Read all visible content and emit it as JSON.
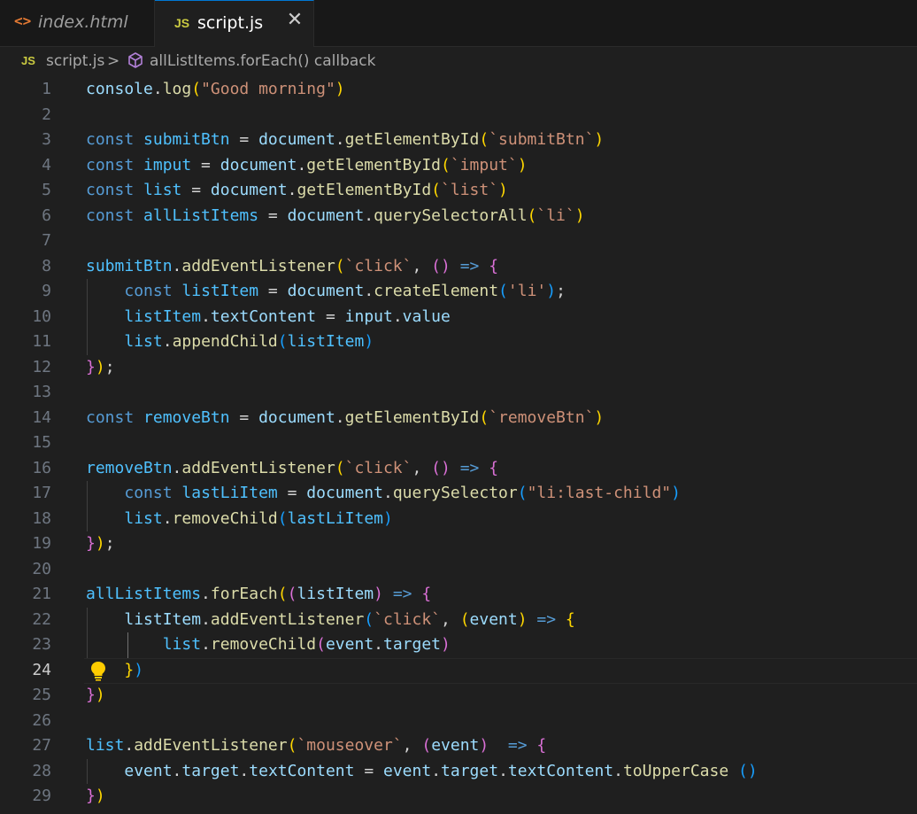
{
  "tabs": [
    {
      "label": "index.html",
      "icon": "<>",
      "active": false
    },
    {
      "label": "script.js",
      "icon": "JS",
      "active": true,
      "close": "✕"
    }
  ],
  "breadcrumb": {
    "file_icon": "JS",
    "file": "script.js",
    "separator": ">",
    "symbol": "allListItems.forEach() callback"
  },
  "editor": {
    "current_line": 24,
    "lines": [
      {
        "n": "1",
        "tokens": [
          [
            "v",
            "console"
          ],
          [
            "p",
            "."
          ],
          [
            "f",
            "log"
          ],
          [
            "b1",
            "("
          ],
          [
            "s",
            "\"Good morning\""
          ],
          [
            "b1",
            ")"
          ]
        ]
      },
      {
        "n": "2",
        "tokens": []
      },
      {
        "n": "3",
        "tokens": [
          [
            "k",
            "const "
          ],
          [
            "c",
            "submitBtn"
          ],
          [
            "p",
            " = "
          ],
          [
            "v",
            "document"
          ],
          [
            "p",
            "."
          ],
          [
            "f",
            "getElementById"
          ],
          [
            "b1",
            "("
          ],
          [
            "s",
            "`submitBtn`"
          ],
          [
            "b1",
            ")"
          ]
        ]
      },
      {
        "n": "4",
        "tokens": [
          [
            "k",
            "const "
          ],
          [
            "c",
            "imput"
          ],
          [
            "p",
            " = "
          ],
          [
            "v",
            "document"
          ],
          [
            "p",
            "."
          ],
          [
            "f",
            "getElementById"
          ],
          [
            "b1",
            "("
          ],
          [
            "s",
            "`imput`"
          ],
          [
            "b1",
            ")"
          ]
        ]
      },
      {
        "n": "5",
        "tokens": [
          [
            "k",
            "const "
          ],
          [
            "c",
            "list"
          ],
          [
            "p",
            " = "
          ],
          [
            "v",
            "document"
          ],
          [
            "p",
            "."
          ],
          [
            "f",
            "getElementById"
          ],
          [
            "b1",
            "("
          ],
          [
            "s",
            "`list`"
          ],
          [
            "b1",
            ")"
          ]
        ]
      },
      {
        "n": "6",
        "tokens": [
          [
            "k",
            "const "
          ],
          [
            "c",
            "allListItems"
          ],
          [
            "p",
            " = "
          ],
          [
            "v",
            "document"
          ],
          [
            "p",
            "."
          ],
          [
            "f",
            "querySelectorAll"
          ],
          [
            "b1",
            "("
          ],
          [
            "s",
            "`li`"
          ],
          [
            "b1",
            ")"
          ]
        ]
      },
      {
        "n": "7",
        "tokens": []
      },
      {
        "n": "8",
        "tokens": [
          [
            "c",
            "submitBtn"
          ],
          [
            "p",
            "."
          ],
          [
            "f",
            "addEventListener"
          ],
          [
            "b1",
            "("
          ],
          [
            "s",
            "`click`"
          ],
          [
            "p",
            ", "
          ],
          [
            "b2",
            "()"
          ],
          [
            "k",
            " => "
          ],
          [
            "b2",
            "{"
          ]
        ]
      },
      {
        "n": "9",
        "guide": 1,
        "tokens": [
          [
            "p",
            "    "
          ],
          [
            "k",
            "const "
          ],
          [
            "c",
            "listItem"
          ],
          [
            "p",
            " = "
          ],
          [
            "v",
            "document"
          ],
          [
            "p",
            "."
          ],
          [
            "f",
            "createElement"
          ],
          [
            "b3",
            "("
          ],
          [
            "s",
            "'li'"
          ],
          [
            "b3",
            ")"
          ],
          [
            "p",
            ";"
          ]
        ]
      },
      {
        "n": "10",
        "guide": 1,
        "tokens": [
          [
            "p",
            "    "
          ],
          [
            "c",
            "listItem"
          ],
          [
            "p",
            "."
          ],
          [
            "v",
            "textContent"
          ],
          [
            "p",
            " = "
          ],
          [
            "v",
            "input"
          ],
          [
            "p",
            "."
          ],
          [
            "v",
            "value"
          ]
        ]
      },
      {
        "n": "11",
        "guide": 1,
        "tokens": [
          [
            "p",
            "    "
          ],
          [
            "c",
            "list"
          ],
          [
            "p",
            "."
          ],
          [
            "f",
            "appendChild"
          ],
          [
            "b3",
            "("
          ],
          [
            "c",
            "listItem"
          ],
          [
            "b3",
            ")"
          ]
        ]
      },
      {
        "n": "12",
        "tokens": [
          [
            "b2",
            "}"
          ],
          [
            "b1",
            ")"
          ],
          [
            "p",
            ";"
          ]
        ]
      },
      {
        "n": "13",
        "tokens": []
      },
      {
        "n": "14",
        "tokens": [
          [
            "k",
            "const "
          ],
          [
            "c",
            "removeBtn"
          ],
          [
            "p",
            " = "
          ],
          [
            "v",
            "document"
          ],
          [
            "p",
            "."
          ],
          [
            "f",
            "getElementById"
          ],
          [
            "b1",
            "("
          ],
          [
            "s",
            "`removeBtn`"
          ],
          [
            "b1",
            ")"
          ]
        ]
      },
      {
        "n": "15",
        "tokens": []
      },
      {
        "n": "16",
        "tokens": [
          [
            "c",
            "removeBtn"
          ],
          [
            "p",
            "."
          ],
          [
            "f",
            "addEventListener"
          ],
          [
            "b1",
            "("
          ],
          [
            "s",
            "`click`"
          ],
          [
            "p",
            ", "
          ],
          [
            "b2",
            "()"
          ],
          [
            "k",
            " => "
          ],
          [
            "b2",
            "{"
          ]
        ]
      },
      {
        "n": "17",
        "guide": 1,
        "tokens": [
          [
            "p",
            "    "
          ],
          [
            "k",
            "const "
          ],
          [
            "c",
            "lastLiItem"
          ],
          [
            "p",
            " = "
          ],
          [
            "v",
            "document"
          ],
          [
            "p",
            "."
          ],
          [
            "f",
            "querySelector"
          ],
          [
            "b3",
            "("
          ],
          [
            "s",
            "\"li:last-child\""
          ],
          [
            "b3",
            ")"
          ]
        ]
      },
      {
        "n": "18",
        "guide": 1,
        "tokens": [
          [
            "p",
            "    "
          ],
          [
            "c",
            "list"
          ],
          [
            "p",
            "."
          ],
          [
            "f",
            "removeChild"
          ],
          [
            "b3",
            "("
          ],
          [
            "c",
            "lastLiItem"
          ],
          [
            "b3",
            ")"
          ]
        ]
      },
      {
        "n": "19",
        "tokens": [
          [
            "b2",
            "}"
          ],
          [
            "b1",
            ")"
          ],
          [
            "p",
            ";"
          ]
        ]
      },
      {
        "n": "20",
        "tokens": []
      },
      {
        "n": "21",
        "tokens": [
          [
            "c",
            "allListItems"
          ],
          [
            "p",
            "."
          ],
          [
            "f",
            "forEach"
          ],
          [
            "b1",
            "("
          ],
          [
            "b2",
            "("
          ],
          [
            "v",
            "listItem"
          ],
          [
            "b2",
            ")"
          ],
          [
            "k",
            " => "
          ],
          [
            "b2",
            "{"
          ]
        ]
      },
      {
        "n": "22",
        "guide": 1,
        "tokens": [
          [
            "p",
            "    "
          ],
          [
            "v",
            "listItem"
          ],
          [
            "p",
            "."
          ],
          [
            "f",
            "addEventListener"
          ],
          [
            "b3",
            "("
          ],
          [
            "s",
            "`click`"
          ],
          [
            "p",
            ", "
          ],
          [
            "b1",
            "("
          ],
          [
            "v",
            "event"
          ],
          [
            "b1",
            ")"
          ],
          [
            "k",
            " => "
          ],
          [
            "b1",
            "{"
          ]
        ]
      },
      {
        "n": "23",
        "guide": 2,
        "tokens": [
          [
            "p",
            "        "
          ],
          [
            "c",
            "list"
          ],
          [
            "p",
            "."
          ],
          [
            "f",
            "removeChild"
          ],
          [
            "b2",
            "("
          ],
          [
            "v",
            "event"
          ],
          [
            "p",
            "."
          ],
          [
            "v",
            "target"
          ],
          [
            "b2",
            ")"
          ]
        ]
      },
      {
        "n": "24",
        "bulb": true,
        "tokens": [
          [
            "p",
            "    "
          ],
          [
            "b1",
            "}"
          ],
          [
            "b3",
            ")"
          ]
        ]
      },
      {
        "n": "25",
        "tokens": [
          [
            "b2",
            "}"
          ],
          [
            "b1",
            ")"
          ]
        ]
      },
      {
        "n": "26",
        "tokens": []
      },
      {
        "n": "27",
        "tokens": [
          [
            "c",
            "list"
          ],
          [
            "p",
            "."
          ],
          [
            "f",
            "addEventListener"
          ],
          [
            "b1",
            "("
          ],
          [
            "s",
            "`mouseover`"
          ],
          [
            "p",
            ", "
          ],
          [
            "b2",
            "("
          ],
          [
            "v",
            "event"
          ],
          [
            "b2",
            ")"
          ],
          [
            "k",
            "  => "
          ],
          [
            "b2",
            "{"
          ]
        ]
      },
      {
        "n": "28",
        "guide": 1,
        "tokens": [
          [
            "p",
            "    "
          ],
          [
            "v",
            "event"
          ],
          [
            "p",
            "."
          ],
          [
            "v",
            "target"
          ],
          [
            "p",
            "."
          ],
          [
            "v",
            "textContent"
          ],
          [
            "p",
            " = "
          ],
          [
            "v",
            "event"
          ],
          [
            "p",
            "."
          ],
          [
            "v",
            "target"
          ],
          [
            "p",
            "."
          ],
          [
            "v",
            "textContent"
          ],
          [
            "p",
            "."
          ],
          [
            "f",
            "toUpperCase"
          ],
          [
            "p",
            " "
          ],
          [
            "b3",
            "()"
          ]
        ]
      },
      {
        "n": "29",
        "tokens": [
          [
            "b2",
            "}"
          ],
          [
            "b1",
            ")"
          ]
        ]
      }
    ]
  }
}
